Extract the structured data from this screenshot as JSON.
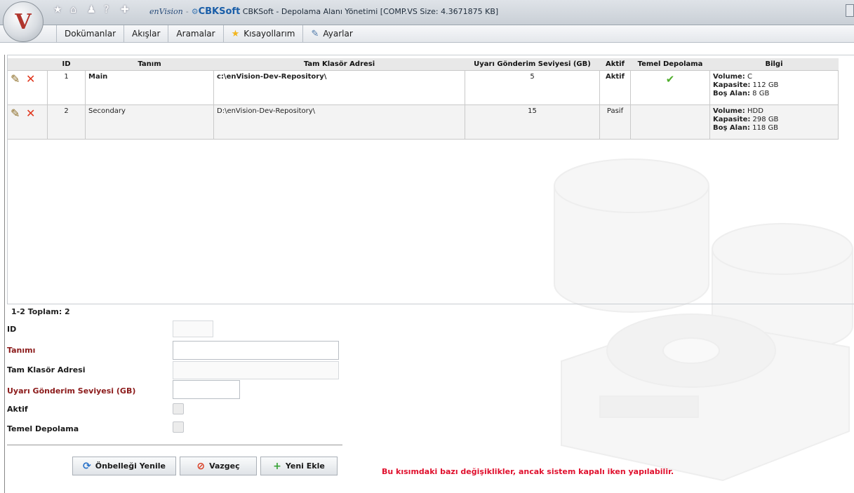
{
  "titlebar": {
    "brand_envision": "enVision",
    "brand_cbk": "CBKSoft",
    "title": "CBKSoft - Depolama Alanı Yönetimi [COMP.VS Size: 4.3671875 KB]",
    "orb_letter": "V"
  },
  "quick_icons": [
    "star-icon",
    "home-icon",
    "user-icon",
    "help-icon",
    "plugin-icon"
  ],
  "menu": [
    {
      "label": "Dokümanlar",
      "icon": ""
    },
    {
      "label": "Akışlar",
      "icon": ""
    },
    {
      "label": "Aramalar",
      "icon": ""
    },
    {
      "label": "Kısayollarım",
      "icon": "star-icon"
    },
    {
      "label": "Ayarlar",
      "icon": "wrench-icon"
    }
  ],
  "grid": {
    "headers": {
      "id": "ID",
      "tanim": "Tanım",
      "adres": "Tam Klasör Adresi",
      "uyari": "Uyarı Gönderim Seviyesi (GB)",
      "aktif": "Aktif",
      "temel": "Temel Depolama",
      "bilgi": "Bilgi"
    },
    "rows": [
      {
        "id": "1",
        "tanim": "Main",
        "adres": "c:\\enVision-Dev-Repository\\",
        "uyari": "5",
        "aktif": "Aktif",
        "temel": true,
        "volume_label": "Volume:",
        "volume": "C",
        "kapasite_label": "Kapasite:",
        "kapasite": "112 GB",
        "bos_label": "Boş Alan:",
        "bos": "8 GB"
      },
      {
        "id": "2",
        "tanim": "Secondary",
        "adres": "D:\\enVision-Dev-Repository\\",
        "uyari": "15",
        "aktif": "Pasif",
        "temel": false,
        "volume_label": "Volume:",
        "volume": "HDD",
        "kapasite_label": "Kapasite:",
        "kapasite": "298 GB",
        "bos_label": "Boş Alan:",
        "bos": "118 GB"
      }
    ],
    "total": "1-2 Toplam: 2"
  },
  "form": {
    "id_label": "ID",
    "tanim_label": "Tanımı",
    "adres_label": "Tam Klasör Adresi",
    "uyari_label": "Uyarı Gönderim Seviyesi (GB)",
    "aktif_label": "Aktif",
    "temel_label": "Temel Depolama",
    "id_value": "",
    "tanim_value": "",
    "adres_value": "",
    "uyari_value": ""
  },
  "buttons": {
    "refresh": "Önbelleği Yenile",
    "cancel": "Vazgeç",
    "add": "Yeni Ekle"
  },
  "warning": "Bu kısımdaki bazı değişiklikler, ancak sistem kapalı iken yapılabilir.",
  "colors": {
    "required_label": "#8b1a1a",
    "warning_text": "#e0102d",
    "check_green": "#4fae2c"
  }
}
